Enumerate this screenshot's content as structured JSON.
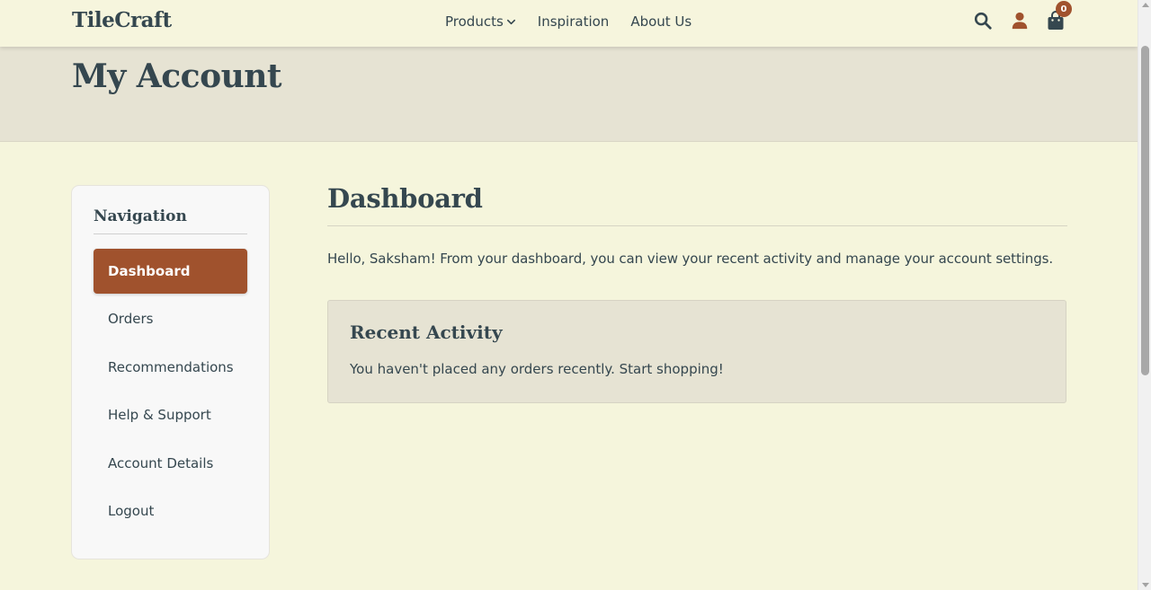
{
  "header": {
    "logo": "TileCraft",
    "nav": [
      {
        "label": "Products"
      },
      {
        "label": "Inspiration"
      },
      {
        "label": "About Us"
      }
    ],
    "cart_count": "0"
  },
  "banner": {
    "title": "My Account"
  },
  "sidebar": {
    "heading": "Navigation",
    "items": [
      {
        "label": "Dashboard",
        "active": true
      },
      {
        "label": "Orders"
      },
      {
        "label": "Recommendations"
      },
      {
        "label": "Help & Support"
      },
      {
        "label": "Account Details"
      },
      {
        "label": "Logout"
      }
    ]
  },
  "main": {
    "title": "Dashboard",
    "greeting": "Hello, Saksham! From your dashboard, you can view your recent activity and manage your account settings.",
    "activity": {
      "title": "Recent Activity",
      "text": "You haven't placed any orders recently. Start shopping!"
    }
  },
  "colors": {
    "accent": "#a0522d",
    "background": "#f5f5dc",
    "panel": "#e6e3d3",
    "text": "#35474f"
  },
  "icons": {
    "search": "search-icon",
    "user": "user-icon",
    "cart": "shopping-bag-icon",
    "chevron": "chevron-down-icon"
  }
}
